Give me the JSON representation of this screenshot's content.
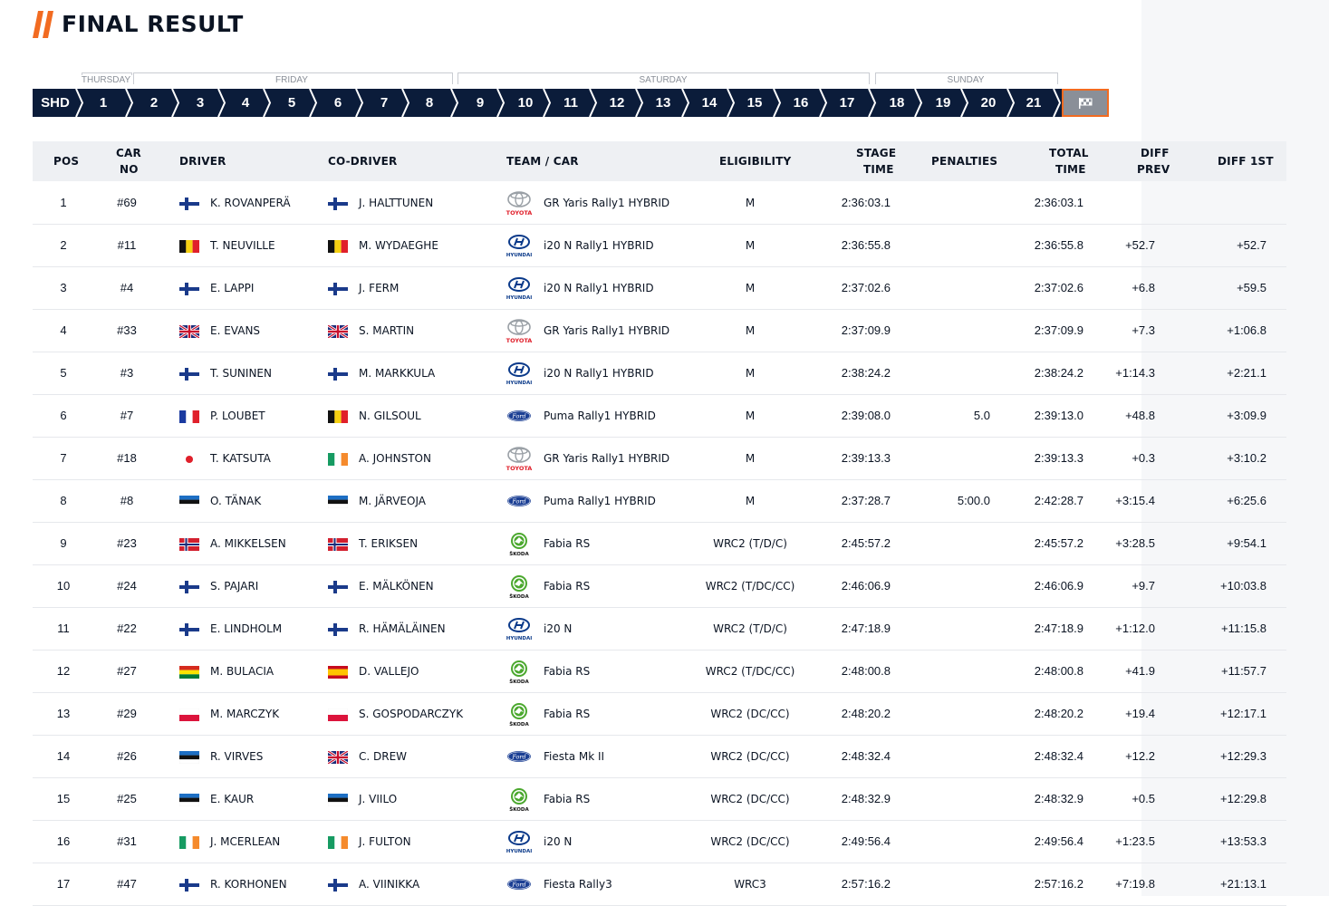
{
  "page": {
    "title": "FINAL RESULT"
  },
  "colors": {
    "accent": "#f26b21",
    "navy": "#0b1c3a",
    "flagTab": "#8a8f98"
  },
  "days": [
    {
      "label": "THURSDAY"
    },
    {
      "label": "FRIDAY"
    },
    {
      "label": "SATURDAY"
    },
    {
      "label": "SUNDAY"
    }
  ],
  "stages": [
    "SHD",
    "1",
    "2",
    "3",
    "4",
    "5",
    "6",
    "7",
    "8",
    "9",
    "10",
    "11",
    "12",
    "13",
    "14",
    "15",
    "16",
    "17",
    "18",
    "19",
    "20",
    "21"
  ],
  "finish_icon": "checkered-flag-icon",
  "columns": {
    "pos": "POS",
    "car_no_1": "CAR",
    "car_no_2": "NO",
    "driver": "DRIVER",
    "co_driver": "CO-DRIVER",
    "team_car": "TEAM / CAR",
    "eligibility": "ELIGIBILITY",
    "stage_time_1": "STAGE",
    "stage_time_2": "TIME",
    "penalties": "PENALTIES",
    "total_time_1": "TOTAL",
    "total_time_2": "TIME",
    "diff_prev_1": "DIFF",
    "diff_prev_2": "PREV",
    "diff_first": "DIFF 1ST"
  },
  "rows": [
    {
      "pos": "1",
      "car": "#69",
      "driver_flag": "fin",
      "driver": "K. ROVANPERÄ",
      "co_flag": "fin",
      "co_driver": "J. HALTTUNEN",
      "team_logo": "toyota",
      "car_model": "GR Yaris Rally1 HYBRID",
      "elig": "M",
      "stage_time": "2:36:03.1",
      "penalties": "",
      "total": "2:36:03.1",
      "diff_prev": "",
      "diff_first": ""
    },
    {
      "pos": "2",
      "car": "#11",
      "driver_flag": "bel",
      "driver": "T. NEUVILLE",
      "co_flag": "bel",
      "co_driver": "M. WYDAEGHE",
      "team_logo": "hyundai",
      "car_model": "i20 N Rally1 HYBRID",
      "elig": "M",
      "stage_time": "2:36:55.8",
      "penalties": "",
      "total": "2:36:55.8",
      "diff_prev": "+52.7",
      "diff_first": "+52.7"
    },
    {
      "pos": "3",
      "car": "#4",
      "driver_flag": "fin",
      "driver": "E. LAPPI",
      "co_flag": "fin",
      "co_driver": "J. FERM",
      "team_logo": "hyundai",
      "car_model": "i20 N Rally1 HYBRID",
      "elig": "M",
      "stage_time": "2:37:02.6",
      "penalties": "",
      "total": "2:37:02.6",
      "diff_prev": "+6.8",
      "diff_first": "+59.5"
    },
    {
      "pos": "4",
      "car": "#33",
      "driver_flag": "gbr",
      "driver": "E. EVANS",
      "co_flag": "gbr",
      "co_driver": "S. MARTIN",
      "team_logo": "toyota",
      "car_model": "GR Yaris Rally1 HYBRID",
      "elig": "M",
      "stage_time": "2:37:09.9",
      "penalties": "",
      "total": "2:37:09.9",
      "diff_prev": "+7.3",
      "diff_first": "+1:06.8"
    },
    {
      "pos": "5",
      "car": "#3",
      "driver_flag": "fin",
      "driver": "T. SUNINEN",
      "co_flag": "fin",
      "co_driver": "M. MARKKULA",
      "team_logo": "hyundai",
      "car_model": "i20 N Rally1 HYBRID",
      "elig": "M",
      "stage_time": "2:38:24.2",
      "penalties": "",
      "total": "2:38:24.2",
      "diff_prev": "+1:14.3",
      "diff_first": "+2:21.1"
    },
    {
      "pos": "6",
      "car": "#7",
      "driver_flag": "fra",
      "driver": "P. LOUBET",
      "co_flag": "bel",
      "co_driver": "N. GILSOUL",
      "team_logo": "ford",
      "car_model": "Puma Rally1 HYBRID",
      "elig": "M",
      "stage_time": "2:39:08.0",
      "penalties": "5.0",
      "total": "2:39:13.0",
      "diff_prev": "+48.8",
      "diff_first": "+3:09.9"
    },
    {
      "pos": "7",
      "car": "#18",
      "driver_flag": "jpn",
      "driver": "T. KATSUTA",
      "co_flag": "irl",
      "co_driver": "A. JOHNSTON",
      "team_logo": "toyota",
      "car_model": "GR Yaris Rally1 HYBRID",
      "elig": "M",
      "stage_time": "2:39:13.3",
      "penalties": "",
      "total": "2:39:13.3",
      "diff_prev": "+0.3",
      "diff_first": "+3:10.2"
    },
    {
      "pos": "8",
      "car": "#8",
      "driver_flag": "est",
      "driver": "O. TÄNAK",
      "co_flag": "est",
      "co_driver": "M. JÄRVEOJA",
      "team_logo": "ford",
      "car_model": "Puma Rally1 HYBRID",
      "elig": "M",
      "stage_time": "2:37:28.7",
      "penalties": "5:00.0",
      "total": "2:42:28.7",
      "diff_prev": "+3:15.4",
      "diff_first": "+6:25.6"
    },
    {
      "pos": "9",
      "car": "#23",
      "driver_flag": "nor",
      "driver": "A. MIKKELSEN",
      "co_flag": "nor",
      "co_driver": "T. ERIKSEN",
      "team_logo": "skoda",
      "car_model": "Fabia RS",
      "elig": "WRC2 (T/D/C)",
      "stage_time": "2:45:57.2",
      "penalties": "",
      "total": "2:45:57.2",
      "diff_prev": "+3:28.5",
      "diff_first": "+9:54.1"
    },
    {
      "pos": "10",
      "car": "#24",
      "driver_flag": "fin",
      "driver": "S. PAJARI",
      "co_flag": "fin",
      "co_driver": "E. MÄLKÖNEN",
      "team_logo": "skoda",
      "car_model": "Fabia RS",
      "elig": "WRC2 (T/DC/CC)",
      "stage_time": "2:46:06.9",
      "penalties": "",
      "total": "2:46:06.9",
      "diff_prev": "+9.7",
      "diff_first": "+10:03.8"
    },
    {
      "pos": "11",
      "car": "#22",
      "driver_flag": "fin",
      "driver": "E. LINDHOLM",
      "co_flag": "fin",
      "co_driver": "R. HÄMÄLÄINEN",
      "team_logo": "hyundai",
      "car_model": "i20 N",
      "elig": "WRC2 (T/D/C)",
      "stage_time": "2:47:18.9",
      "penalties": "",
      "total": "2:47:18.9",
      "diff_prev": "+1:12.0",
      "diff_first": "+11:15.8"
    },
    {
      "pos": "12",
      "car": "#27",
      "driver_flag": "bol",
      "driver": "M. BULACIA",
      "co_flag": "esp",
      "co_driver": "D. VALLEJO",
      "team_logo": "skoda",
      "car_model": "Fabia RS",
      "elig": "WRC2 (T/DC/CC)",
      "stage_time": "2:48:00.8",
      "penalties": "",
      "total": "2:48:00.8",
      "diff_prev": "+41.9",
      "diff_first": "+11:57.7"
    },
    {
      "pos": "13",
      "car": "#29",
      "driver_flag": "pol",
      "driver": "M. MARCZYK",
      "co_flag": "pol",
      "co_driver": "S. GOSPODARCZYK",
      "team_logo": "skoda",
      "car_model": "Fabia RS",
      "elig": "WRC2 (DC/CC)",
      "stage_time": "2:48:20.2",
      "penalties": "",
      "total": "2:48:20.2",
      "diff_prev": "+19.4",
      "diff_first": "+12:17.1"
    },
    {
      "pos": "14",
      "car": "#26",
      "driver_flag": "est",
      "driver": "R. VIRVES",
      "co_flag": "gbr",
      "co_driver": "C. DREW",
      "team_logo": "ford",
      "car_model": "Fiesta Mk II",
      "elig": "WRC2 (DC/CC)",
      "stage_time": "2:48:32.4",
      "penalties": "",
      "total": "2:48:32.4",
      "diff_prev": "+12.2",
      "diff_first": "+12:29.3"
    },
    {
      "pos": "15",
      "car": "#25",
      "driver_flag": "est",
      "driver": "E. KAUR",
      "co_flag": "est",
      "co_driver": "J. VIILO",
      "team_logo": "skoda",
      "car_model": "Fabia RS",
      "elig": "WRC2 (DC/CC)",
      "stage_time": "2:48:32.9",
      "penalties": "",
      "total": "2:48:32.9",
      "diff_prev": "+0.5",
      "diff_first": "+12:29.8"
    },
    {
      "pos": "16",
      "car": "#31",
      "driver_flag": "irl",
      "driver": "J. MCERLEAN",
      "co_flag": "irl",
      "co_driver": "J. FULTON",
      "team_logo": "hyundai",
      "car_model": "i20 N",
      "elig": "WRC2 (DC/CC)",
      "stage_time": "2:49:56.4",
      "penalties": "",
      "total": "2:49:56.4",
      "diff_prev": "+1:23.5",
      "diff_first": "+13:53.3"
    },
    {
      "pos": "17",
      "car": "#47",
      "driver_flag": "fin",
      "driver": "R. KORHONEN",
      "co_flag": "fin",
      "co_driver": "A. VIINIKKA",
      "team_logo": "ford",
      "car_model": "Fiesta Rally3",
      "elig": "WRC3",
      "stage_time": "2:57:16.2",
      "penalties": "",
      "total": "2:57:16.2",
      "diff_prev": "+7:19.8",
      "diff_first": "+21:13.1"
    }
  ]
}
